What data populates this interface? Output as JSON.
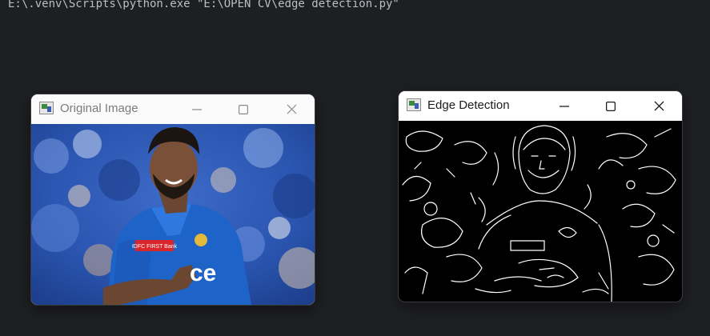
{
  "terminal": {
    "command": "E:\\.venv\\Scripts\\python.exe \"E:\\OPEN CV\\edge detection.py\""
  },
  "windows": [
    {
      "title": "Original Image",
      "state": "inactive"
    },
    {
      "title": "Edge Detection",
      "state": "active"
    }
  ],
  "photo": {
    "jersey_badge": "IDFC FIRST Bank",
    "jersey_text": "ce"
  },
  "colors": {
    "desktop_background": "#1e1f22",
    "terminal_text": "#bcbec4",
    "jersey_blue": "#1e63c8",
    "crowd_blue": "#2a55b0",
    "badge_red": "#d9262c",
    "edge_background": "#000000",
    "edge_lines": "#ffffff"
  },
  "icons": [
    "opencv-window-icon",
    "minimize-icon",
    "maximize-icon",
    "close-icon"
  ]
}
